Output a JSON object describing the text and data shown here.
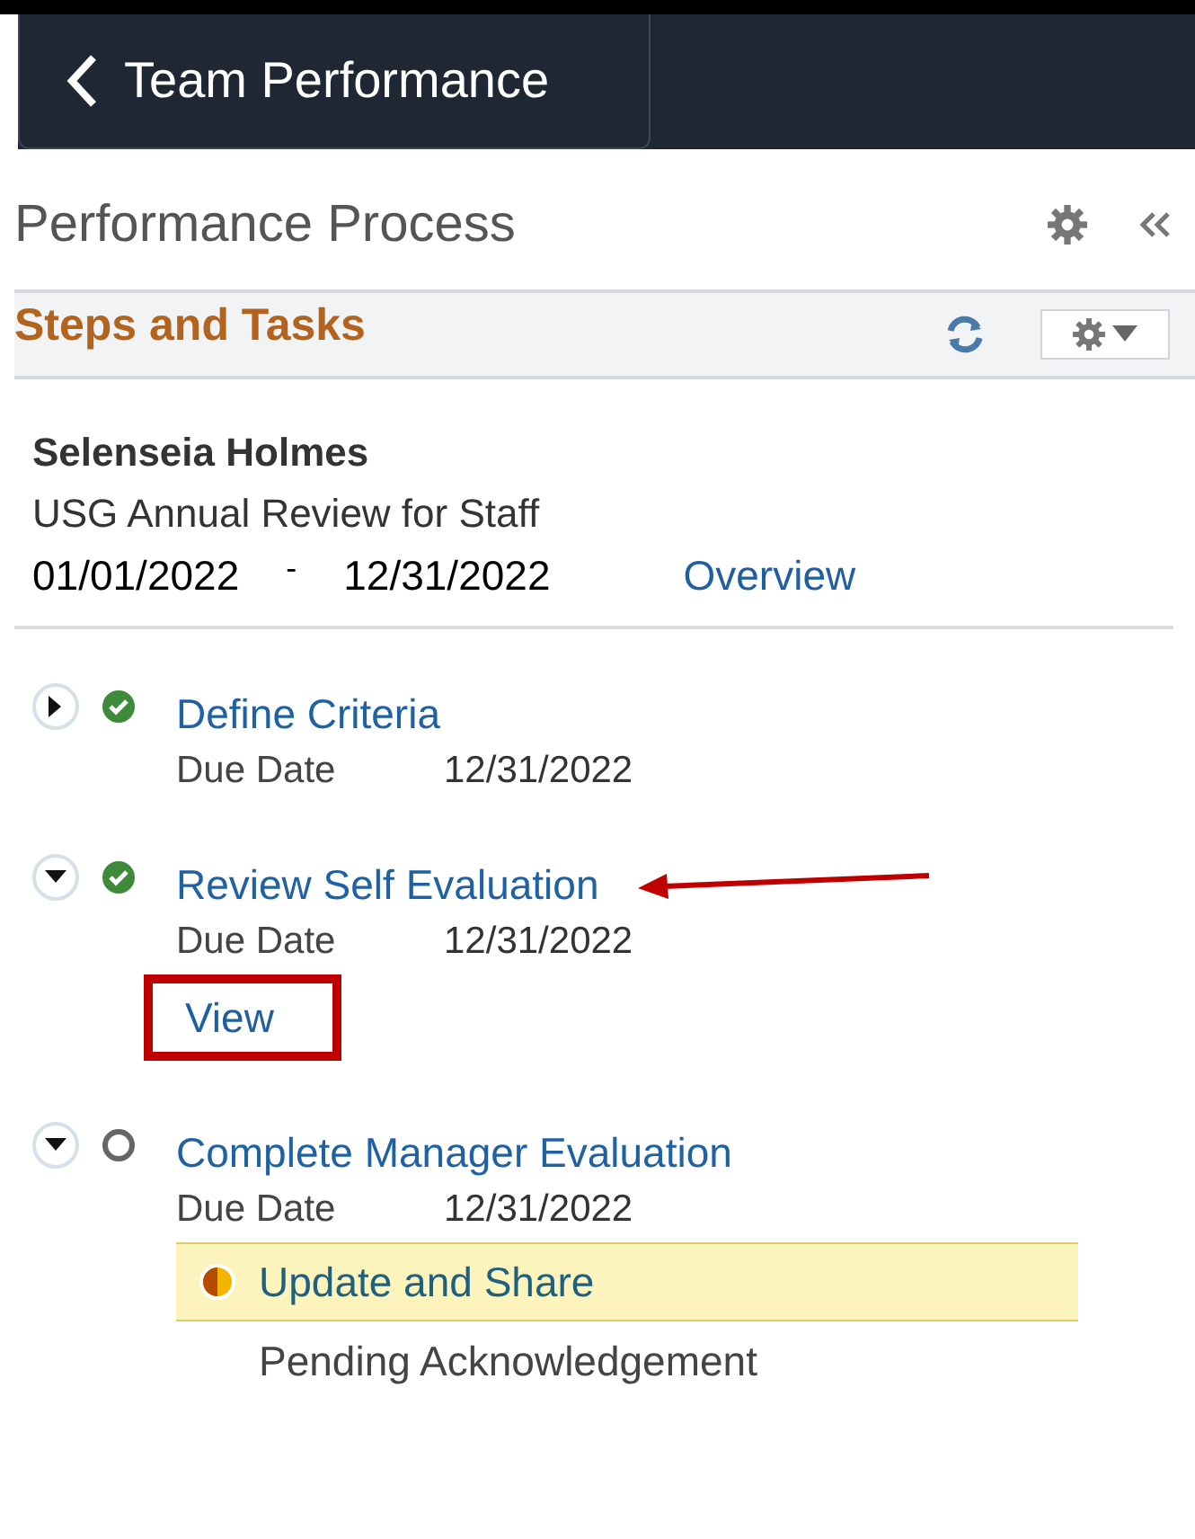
{
  "header": {
    "back_label": "Team Performance"
  },
  "page_title": "Performance Process",
  "section": {
    "title": "Steps and Tasks"
  },
  "employee": {
    "name": "Selenseia Holmes",
    "document": "USG Annual Review for Staff",
    "start_date": "01/01/2022",
    "separator": "-",
    "end_date": "12/31/2022",
    "link": "Overview"
  },
  "steps": [
    {
      "title": "Define Criteria",
      "expanded": false,
      "kind": "complete",
      "arrow": false,
      "due_label": "Due Date",
      "due_date": "12/31/2022"
    },
    {
      "title": "Review Self Evaluation",
      "expanded": true,
      "kind": "complete",
      "arrow": true,
      "due_label": "Due Date",
      "due_date": "12/31/2022",
      "action": {
        "label": "View",
        "boxed": true
      }
    },
    {
      "title": "Complete Manager Evaluation",
      "expanded": true,
      "kind": "pending",
      "arrow": false,
      "due_label": "Due Date",
      "due_date": "12/31/2022",
      "tasks": [
        {
          "label": "Update and Share",
          "kind": "partial",
          "selected": true
        },
        {
          "label": "Pending Acknowledgement",
          "kind": "plain",
          "selected": false
        }
      ]
    }
  ]
}
